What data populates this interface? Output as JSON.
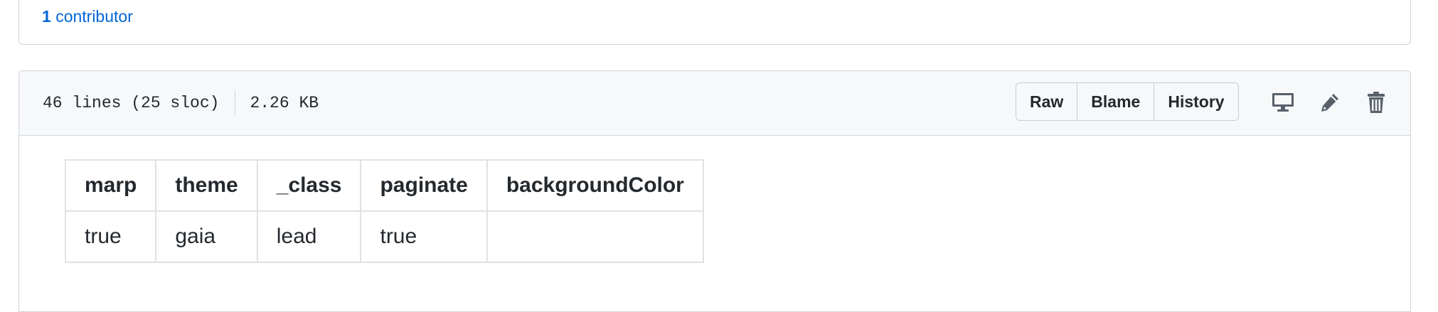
{
  "contributors": {
    "count": "1",
    "label": "contributor"
  },
  "file_header": {
    "lines": "46 lines (25 sloc)",
    "size": "2.26 KB",
    "buttons": [
      "Raw",
      "Blame",
      "History"
    ],
    "icons": [
      "desktop-icon",
      "pencil-icon",
      "trash-icon"
    ]
  },
  "front_matter": {
    "headers": [
      "marp",
      "theme",
      "_class",
      "paginate",
      "backgroundColor"
    ],
    "values": [
      "true",
      "gaia",
      "lead",
      "true",
      ""
    ]
  },
  "colors": {
    "link": "#0366d6",
    "header_bg": "#f6f8fa",
    "border": "#d1d5da",
    "icon": "#586069"
  }
}
